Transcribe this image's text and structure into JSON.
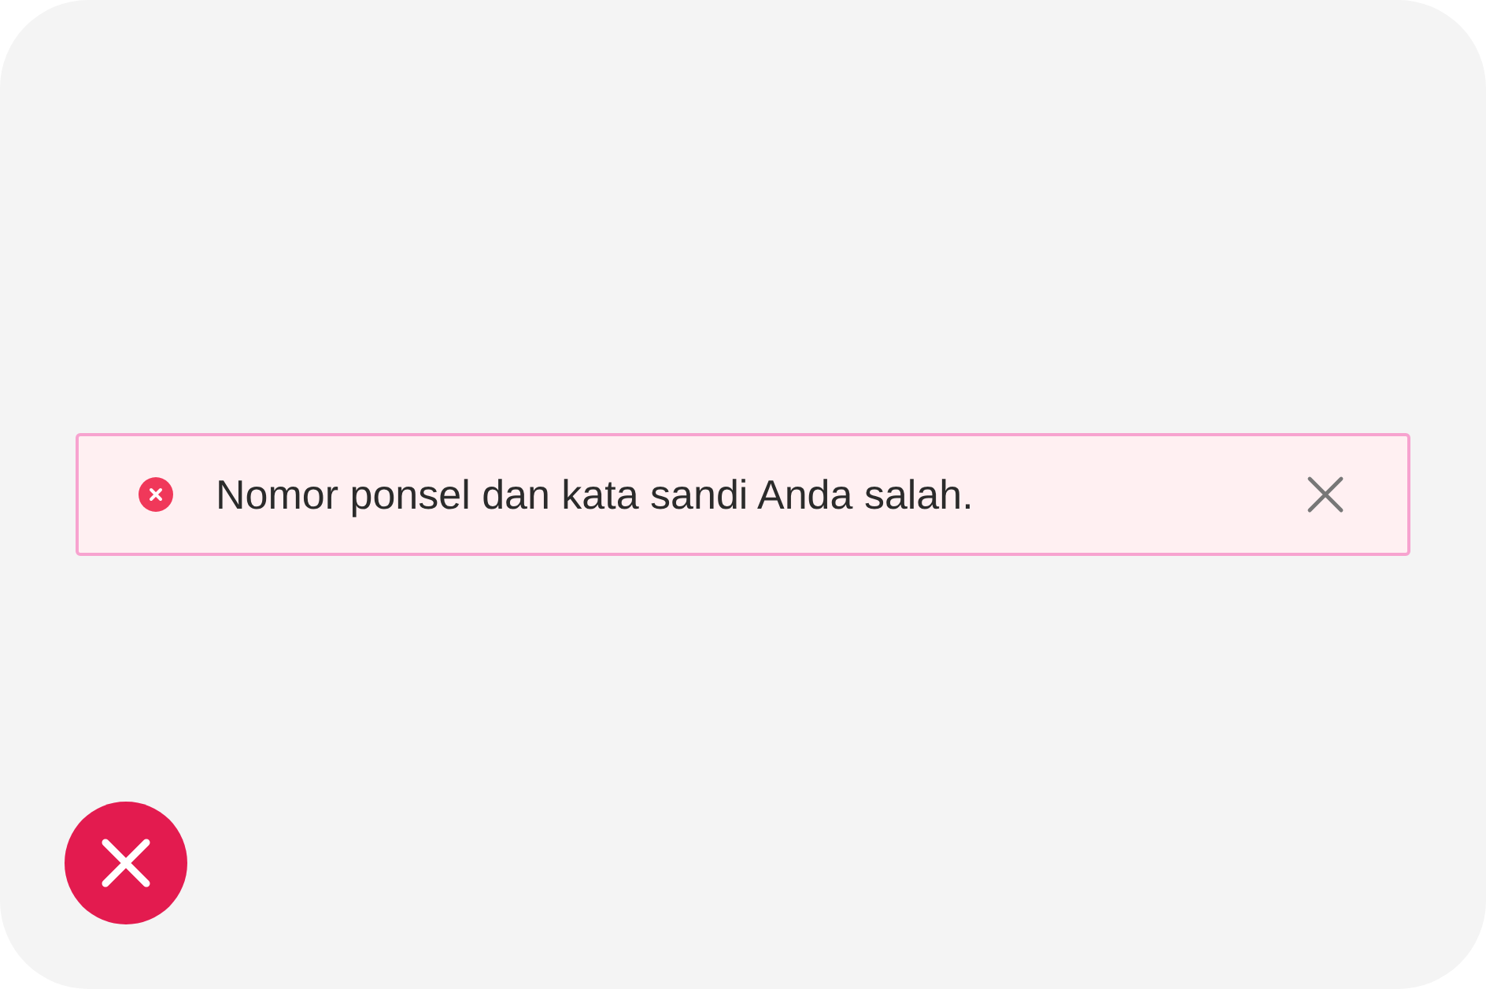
{
  "alert": {
    "kind": "error",
    "message": "Nomor ponsel dan kata sandi Anda salah."
  }
}
